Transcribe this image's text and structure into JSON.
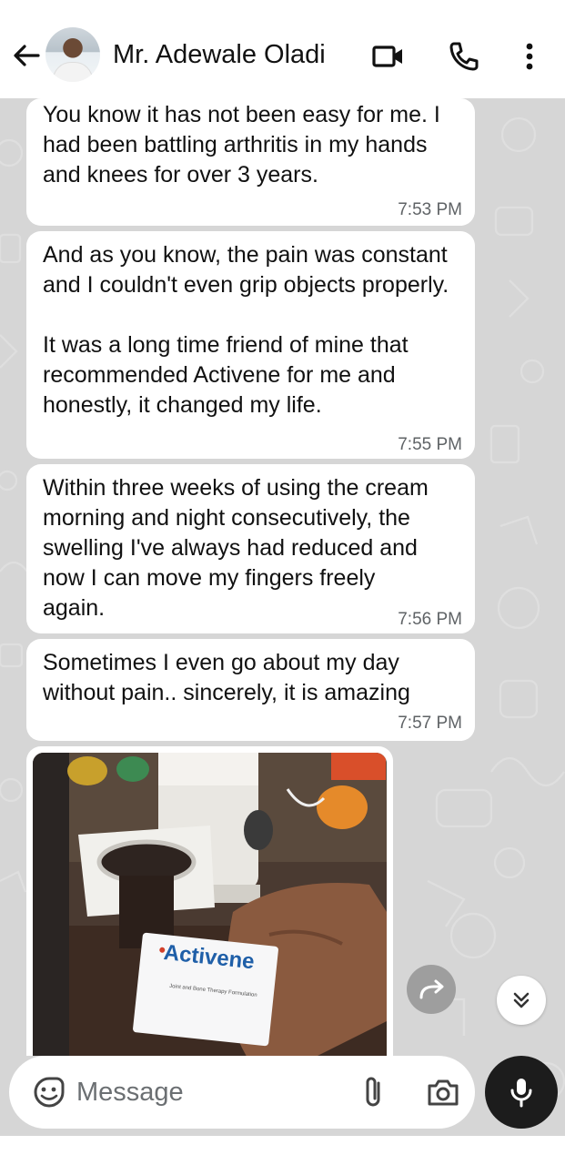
{
  "header": {
    "contact_name": "Mr. Adewale Oladi",
    "icons": [
      "back-arrow-icon",
      "video-call-icon",
      "voice-call-icon",
      "more-options-icon"
    ]
  },
  "messages": [
    {
      "text": "You know it has not been easy for me. I had been battling arthritis in my hands and knees for over 3 years.",
      "time": "7:53 PM"
    },
    {
      "text": "And as you know, the pain was constant and I couldn't even grip objects properly.\n\nIt was a long time friend of mine that recommended Activene for me and honestly, it changed my life.",
      "time": "7:55 PM"
    },
    {
      "text": "Within three weeks of using the cream morning and night consecutively, the swelling I've always had reduced and now I can move my fingers freely again.",
      "time": "7:56 PM"
    },
    {
      "text": "Sometimes I even go about my day without pain.. sincerely, it is amazing",
      "time": "7:57 PM"
    }
  ],
  "image_message": {
    "product_name": "Activene",
    "product_sub": "Joint and Bone Therapy Formulation",
    "icons": [
      "forward-icon",
      "scroll-down-icon"
    ]
  },
  "composer": {
    "placeholder": "Message",
    "icons": [
      "emoji-icon",
      "attach-icon",
      "camera-icon",
      "mic-icon"
    ]
  },
  "colors": {
    "chat_background": "#d6d6d6",
    "bubble": "#ffffff",
    "mic_button": "#1c1c1c"
  }
}
